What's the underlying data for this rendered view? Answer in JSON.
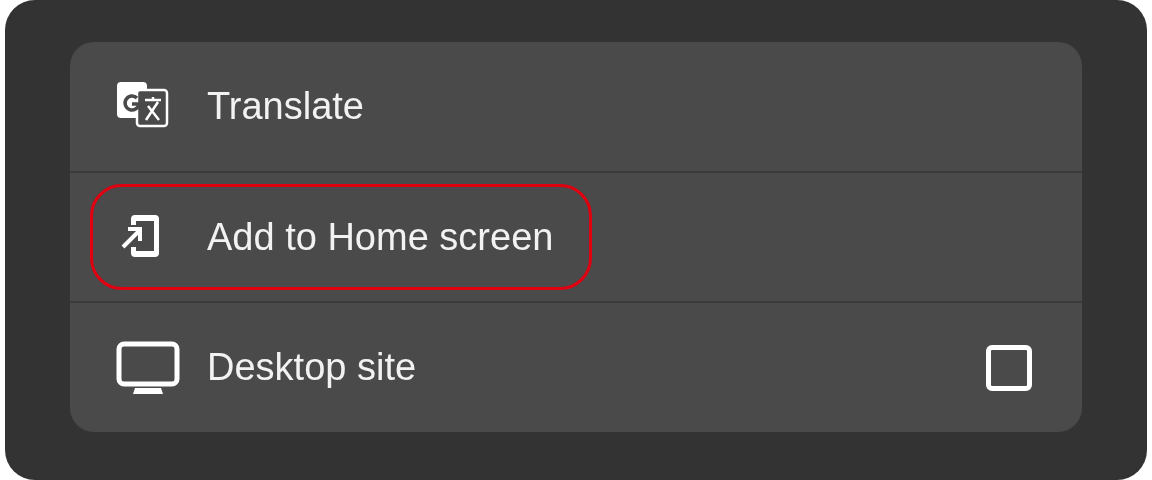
{
  "menu": {
    "items": [
      {
        "kind": "action",
        "label": "Translate",
        "highlighted": false
      },
      {
        "kind": "action",
        "label": "Add to Home screen",
        "highlighted": true
      },
      {
        "kind": "checkbox",
        "label": "Desktop site",
        "checked": false,
        "highlighted": false
      }
    ]
  }
}
